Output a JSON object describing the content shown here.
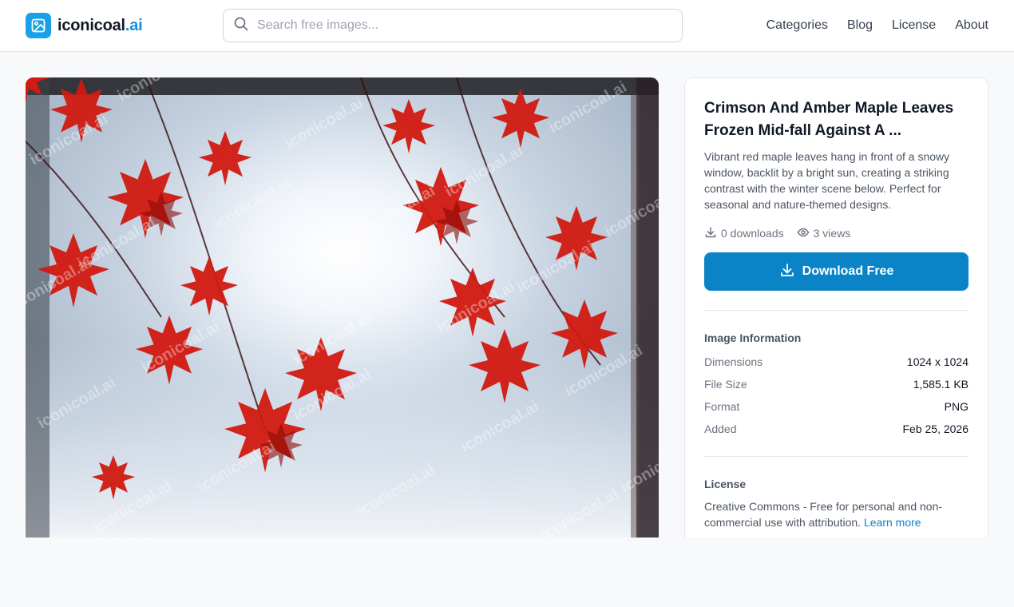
{
  "header": {
    "logo_name": "iconicoal",
    "logo_suffix": ".ai",
    "search_placeholder": "Search free images...",
    "nav": [
      "Categories",
      "Blog",
      "License",
      "About"
    ]
  },
  "image": {
    "watermark": "iconicoal.ai",
    "alt": "Crimson And Amber Maple Leaves Frozen Mid-fall Against A ..."
  },
  "detail": {
    "title": "Crimson And Amber Maple Leaves Frozen Mid-fall Against A ...",
    "description": "Vibrant red maple leaves hang in front of a snowy window, backlit by a bright sun, creating a striking contrast with the winter scene below. Perfect for seasonal and nature-themed designs.",
    "downloads": "0 downloads",
    "views": "3 views",
    "download_button": "Download Free"
  },
  "info": {
    "heading": "Image Information",
    "rows": [
      {
        "label": "Dimensions",
        "value": "1024 x 1024"
      },
      {
        "label": "File Size",
        "value": "1,585.1 KB"
      },
      {
        "label": "Format",
        "value": "PNG"
      },
      {
        "label": "Added",
        "value": "Feb 25, 2026"
      }
    ]
  },
  "license": {
    "heading": "License",
    "text": "Creative Commons - Free for personal and non-commercial use with attribution.",
    "link": "Learn more"
  },
  "colors": {
    "brand": "#1aa0e6",
    "button": "#0a84c6",
    "leaf_red": "#d11a10"
  },
  "icons": [
    "image-logo-icon",
    "search-icon",
    "download-icon",
    "eye-icon"
  ]
}
